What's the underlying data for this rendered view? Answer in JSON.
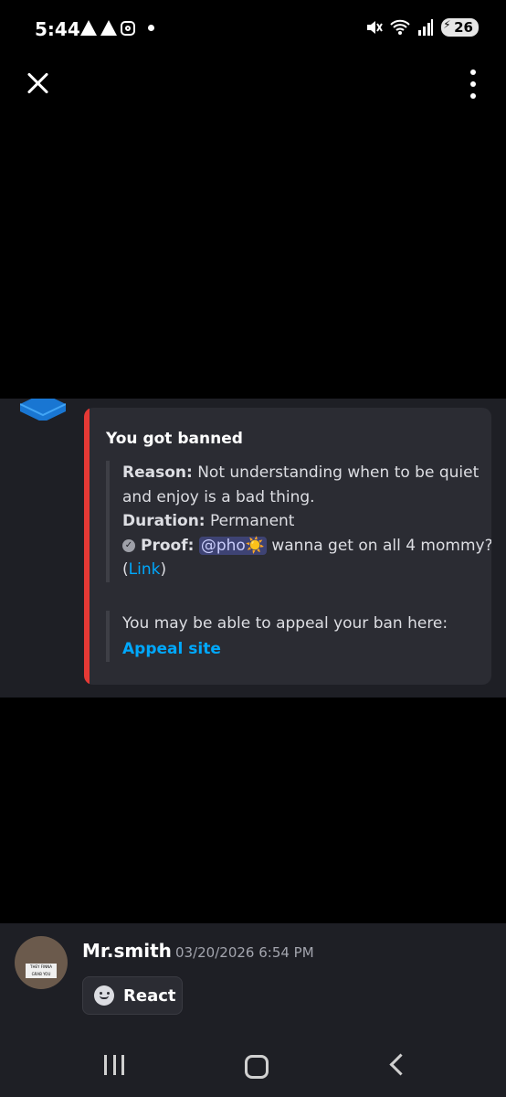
{
  "status_bar": {
    "time": "5:44",
    "battery": "26"
  },
  "embed": {
    "title": "You got banned",
    "reason_label": "Reason:",
    "reason_text": "Not understanding when to be quiet and enjoy is a bad thing.",
    "duration_label": "Duration:",
    "duration_value": "Permanent",
    "proof_label": "Proof:",
    "proof_mention": "@pho☀️",
    "proof_text": "wanna get on all 4 mommy? (",
    "proof_link": "Link",
    "proof_close": ")",
    "appeal_text": "You may be able to appeal your ban here:",
    "appeal_link": "Appeal site",
    "accent_color": "#e53935"
  },
  "message": {
    "username": "Mr.smith",
    "timestamp": "03/20/2026 6:54 PM",
    "react_label": "React",
    "avatar_sign_text": "THEY FINNA GRAB YOU"
  }
}
